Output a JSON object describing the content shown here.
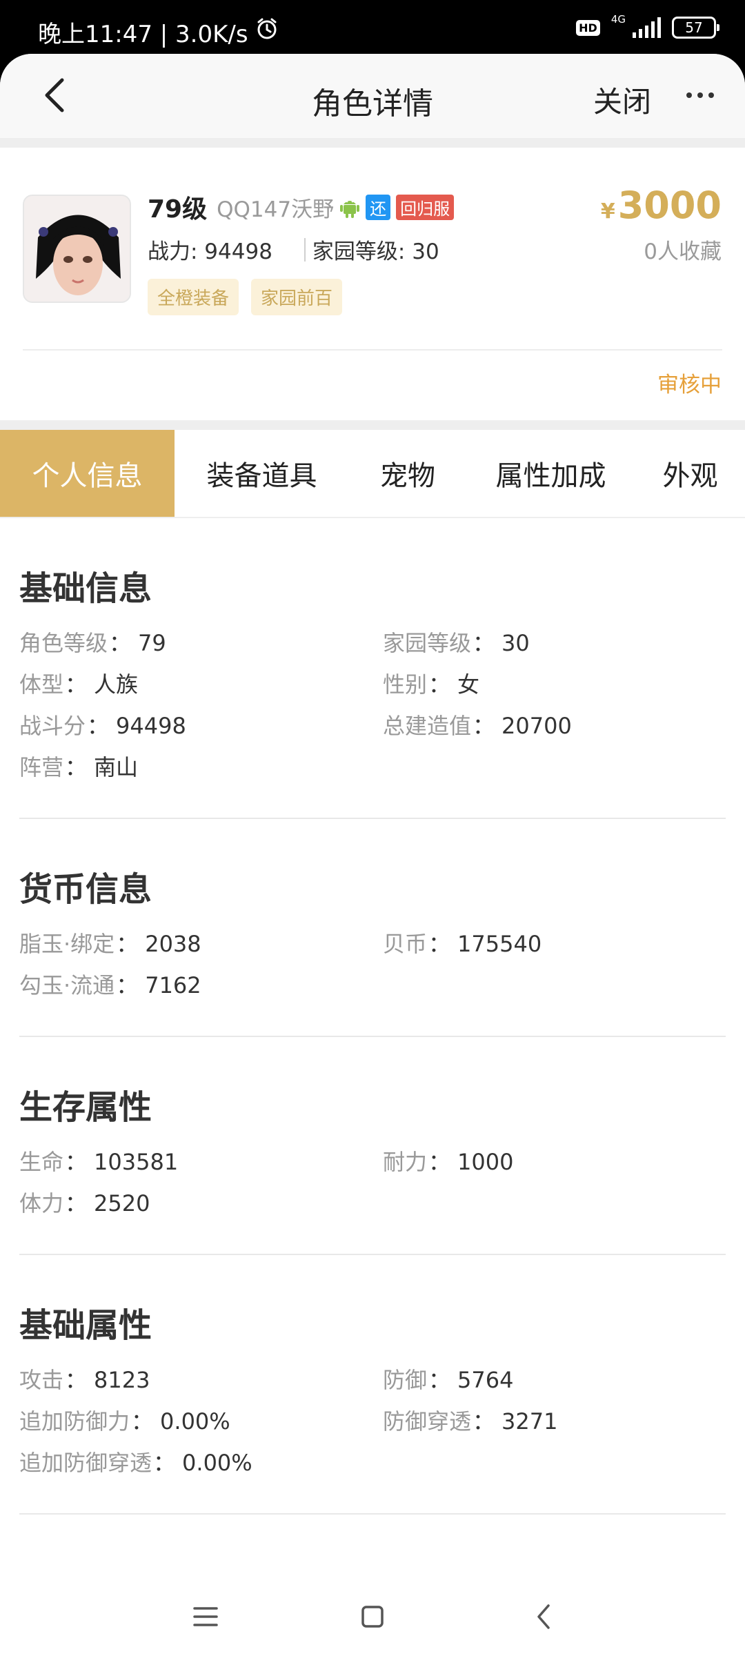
{
  "status_bar": {
    "time_text": "晚上11:47 | 3.0K/s",
    "hd_label": "HD",
    "network_label": "4G",
    "battery": "57"
  },
  "nav": {
    "title": "角色详情",
    "close_label": "关闭"
  },
  "profile": {
    "level": "79级",
    "server": "QQ147沃野",
    "badge_huan": "还",
    "badge_back": "回归服",
    "power": "战力: 94498",
    "home_level": "家园等级: 30",
    "tags": [
      "全橙装备",
      "家园前百"
    ],
    "currency_symbol": "¥",
    "price": "3000",
    "favorites": "0人收藏",
    "status": "审核中"
  },
  "tabs": [
    "个人信息",
    "装备道具",
    "宠物",
    "属性加成",
    "外观"
  ],
  "active_tab": "个人信息",
  "sections": [
    {
      "title": "基础信息",
      "items": [
        {
          "key": "角色等级",
          "value": "79"
        },
        {
          "key": "家园等级",
          "value": "30"
        },
        {
          "key": "体型",
          "value": "人族"
        },
        {
          "key": "性别",
          "value": "女"
        },
        {
          "key": "战斗分",
          "value": "94498"
        },
        {
          "key": "总建造值",
          "value": "20700"
        },
        {
          "key": "阵营",
          "value": "南山"
        }
      ]
    },
    {
      "title": "货币信息",
      "items": [
        {
          "key": "脂玉·绑定",
          "value": "2038"
        },
        {
          "key": "贝币",
          "value": "175540"
        },
        {
          "key": "勾玉·流通",
          "value": "7162"
        }
      ]
    },
    {
      "title": "生存属性",
      "items": [
        {
          "key": "生命",
          "value": "103581"
        },
        {
          "key": "耐力",
          "value": "1000"
        },
        {
          "key": "体力",
          "value": "2520"
        }
      ]
    },
    {
      "title": "基础属性",
      "items": [
        {
          "key": "攻击",
          "value": "8123"
        },
        {
          "key": "防御",
          "value": "5764"
        },
        {
          "key": "追加防御力",
          "value": "0.00%"
        },
        {
          "key": "防御穿透",
          "value": "3271"
        },
        {
          "key": "追加防御穿透",
          "value": "0.00%"
        }
      ]
    }
  ],
  "colors": {
    "accent_gold": "#dcb566",
    "price_gold": "#d4ae59",
    "status_orange": "#e6a03a",
    "tag_bg": "#fbf1d9"
  },
  "icons": [
    "back-arrow-icon",
    "more-dots-icon",
    "android-icon",
    "alarm-icon",
    "menu-icon",
    "home-icon",
    "back-icon"
  ]
}
